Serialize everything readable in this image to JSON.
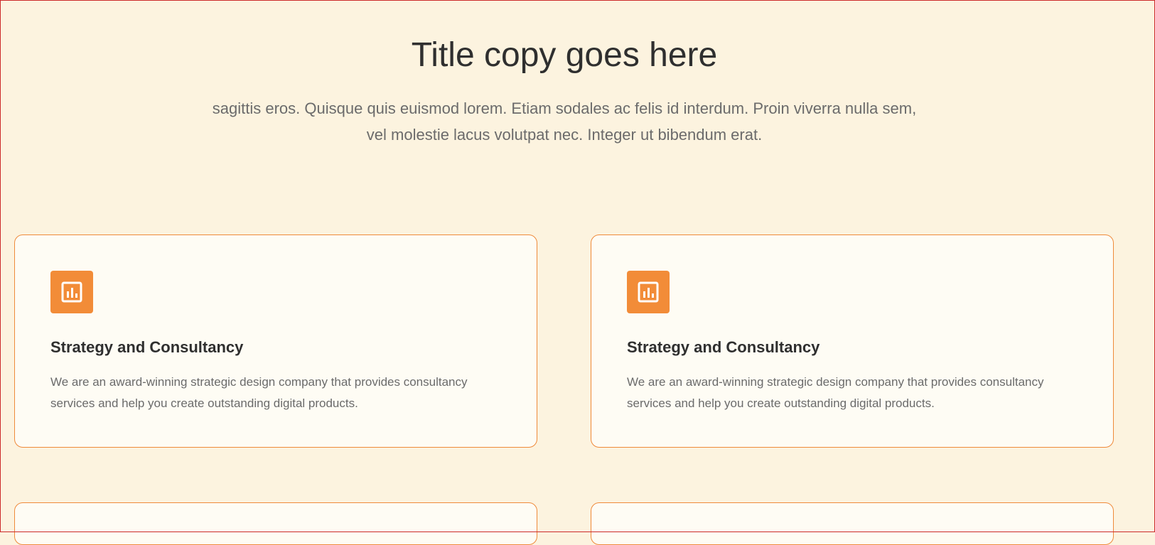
{
  "hero": {
    "title": "Title copy goes here",
    "subtitle": "sagittis eros. Quisque quis euismod lorem. Etiam sodales ac felis id interdum. Proin viverra nulla sem, vel molestie lacus volutpat nec. Integer ut bibendum erat."
  },
  "cards": [
    {
      "icon": "bar-chart-icon",
      "title": "Strategy and Consultancy",
      "description": "We are an award-winning strategic design company that provides consultancy services and help you create outstanding digital products."
    },
    {
      "icon": "bar-chart-icon",
      "title": "Strategy and Consultancy",
      "description": "We are an award-winning strategic design company that provides consultancy services and help you create outstanding digital products."
    }
  ],
  "colors": {
    "background": "#fcf3df",
    "card_background": "#fefcf4",
    "accent": "#f28c38",
    "card_border": "#ef8a3a",
    "heading": "#2f2f2f",
    "body_text": "#6b6b6b"
  }
}
